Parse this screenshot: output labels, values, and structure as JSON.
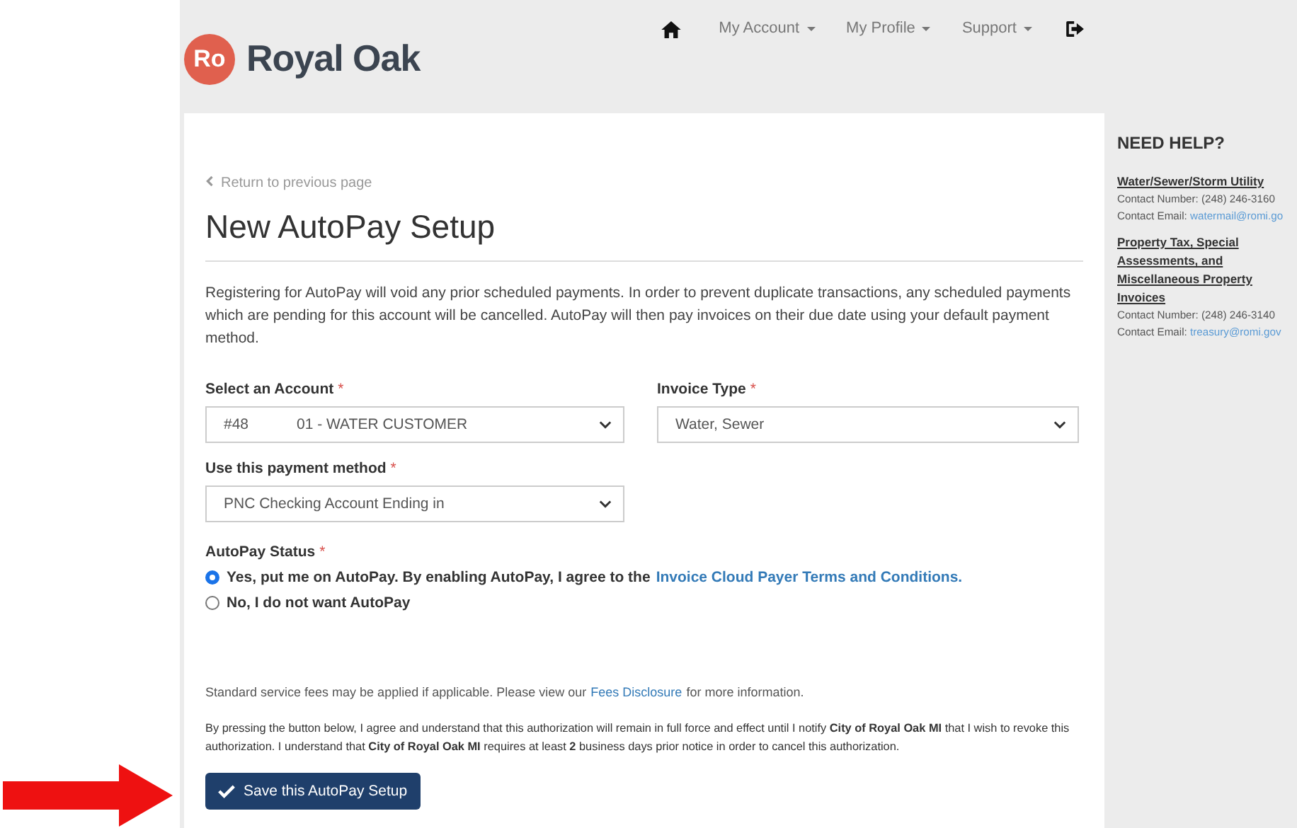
{
  "header": {
    "logo": {
      "mark": "Ro",
      "name": "Royal Oak"
    },
    "nav": [
      {
        "label": "My Account",
        "dropdown": true
      },
      {
        "label": "My Profile",
        "dropdown": true
      },
      {
        "label": "Support",
        "dropdown": true
      }
    ]
  },
  "back_link": "Return to previous page",
  "title": "New AutoPay Setup",
  "intro": "Registering for AutoPay will void any prior scheduled payments. In order to prevent duplicate transactions, any scheduled payments which are pending for this account will be cancelled. AutoPay will then pay invoices on their due date using your default payment method.",
  "fields": [
    {
      "label": "Select an Account",
      "required_mark": "*",
      "value_start": "#48",
      "value_end": "01 - WATER CUSTOMER"
    },
    {
      "label": "Invoice Type",
      "required_mark": "*",
      "value_start": "Water, Sewer"
    },
    {
      "label": "Use this payment method",
      "required_mark": "*",
      "value_start": "PNC Checking Account Ending in"
    }
  ],
  "autopay_status": {
    "label": "AutoPay Status",
    "required_mark": "*",
    "options": [
      {
        "text": "Yes, put me on AutoPay. By enabling AutoPay, I agree to the",
        "link": "Invoice Cloud Payer Terms and Conditions.",
        "selected": true
      },
      {
        "text": "No, I do not want AutoPay",
        "selected": false
      }
    ]
  },
  "fees_note": {
    "before": "Standard service fees may be applied if applicable. Please view our",
    "link": "Fees Disclosure",
    "after": "for more information."
  },
  "authorization": "By pressing the button below, I agree and understand that this authorization will remain in full force and effect until I notify **City of Royal Oak MI** that I wish to revoke this authorization. I understand that **City of Royal Oak MI** requires at least **2** business days prior notice in order to cancel this authorization.",
  "save_button": "Save this AutoPay Setup",
  "help": {
    "title": "NEED HELP?",
    "sections": [
      {
        "heading": "Water/Sewer/Storm Utility",
        "number": "Contact Number: (248) 246-3160",
        "email_label": "Contact Email:",
        "email": "watermail@romi.go"
      },
      {
        "heading": "Property Tax, Special Assessments, and Miscellaneous Property Invoices",
        "number": "Contact Number: (248) 246-3140",
        "email_label": "Contact Email:",
        "email": "treasury@romi.gov"
      }
    ]
  }
}
